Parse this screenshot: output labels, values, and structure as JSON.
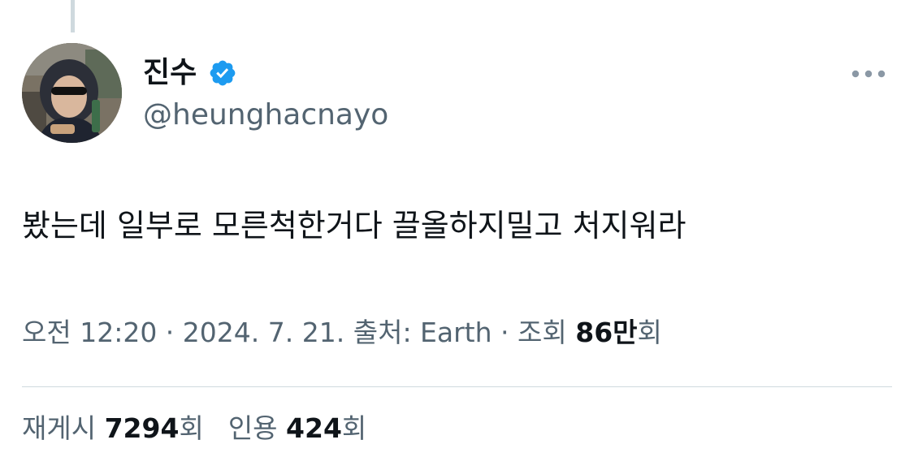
{
  "author": {
    "display_name": "진수",
    "handle": "@heunghacnayo",
    "verified": true
  },
  "icons": {
    "verified": "verified-badge-icon",
    "more": "more-options-icon"
  },
  "colors": {
    "verified_blue": "#1d9bf0",
    "secondary_text": "#536471",
    "primary_text": "#0f1419",
    "divider": "#cfd9de"
  },
  "tweet": {
    "text": "봤는데 일부로 모른척한거다 끌올하지밀고 처지워라"
  },
  "meta": {
    "time": "오전 12:20",
    "separator": " · ",
    "date": "2024. 7. 21.",
    "source_label": "출처: ",
    "source": "Earth",
    "views_label": "조회 ",
    "views_count": "86만",
    "views_suffix": "회"
  },
  "stats": {
    "reposts_label": "재게시 ",
    "reposts_count": "7294",
    "reposts_suffix": "회",
    "quotes_label": "인용 ",
    "quotes_count": "424",
    "quotes_suffix": "회"
  }
}
